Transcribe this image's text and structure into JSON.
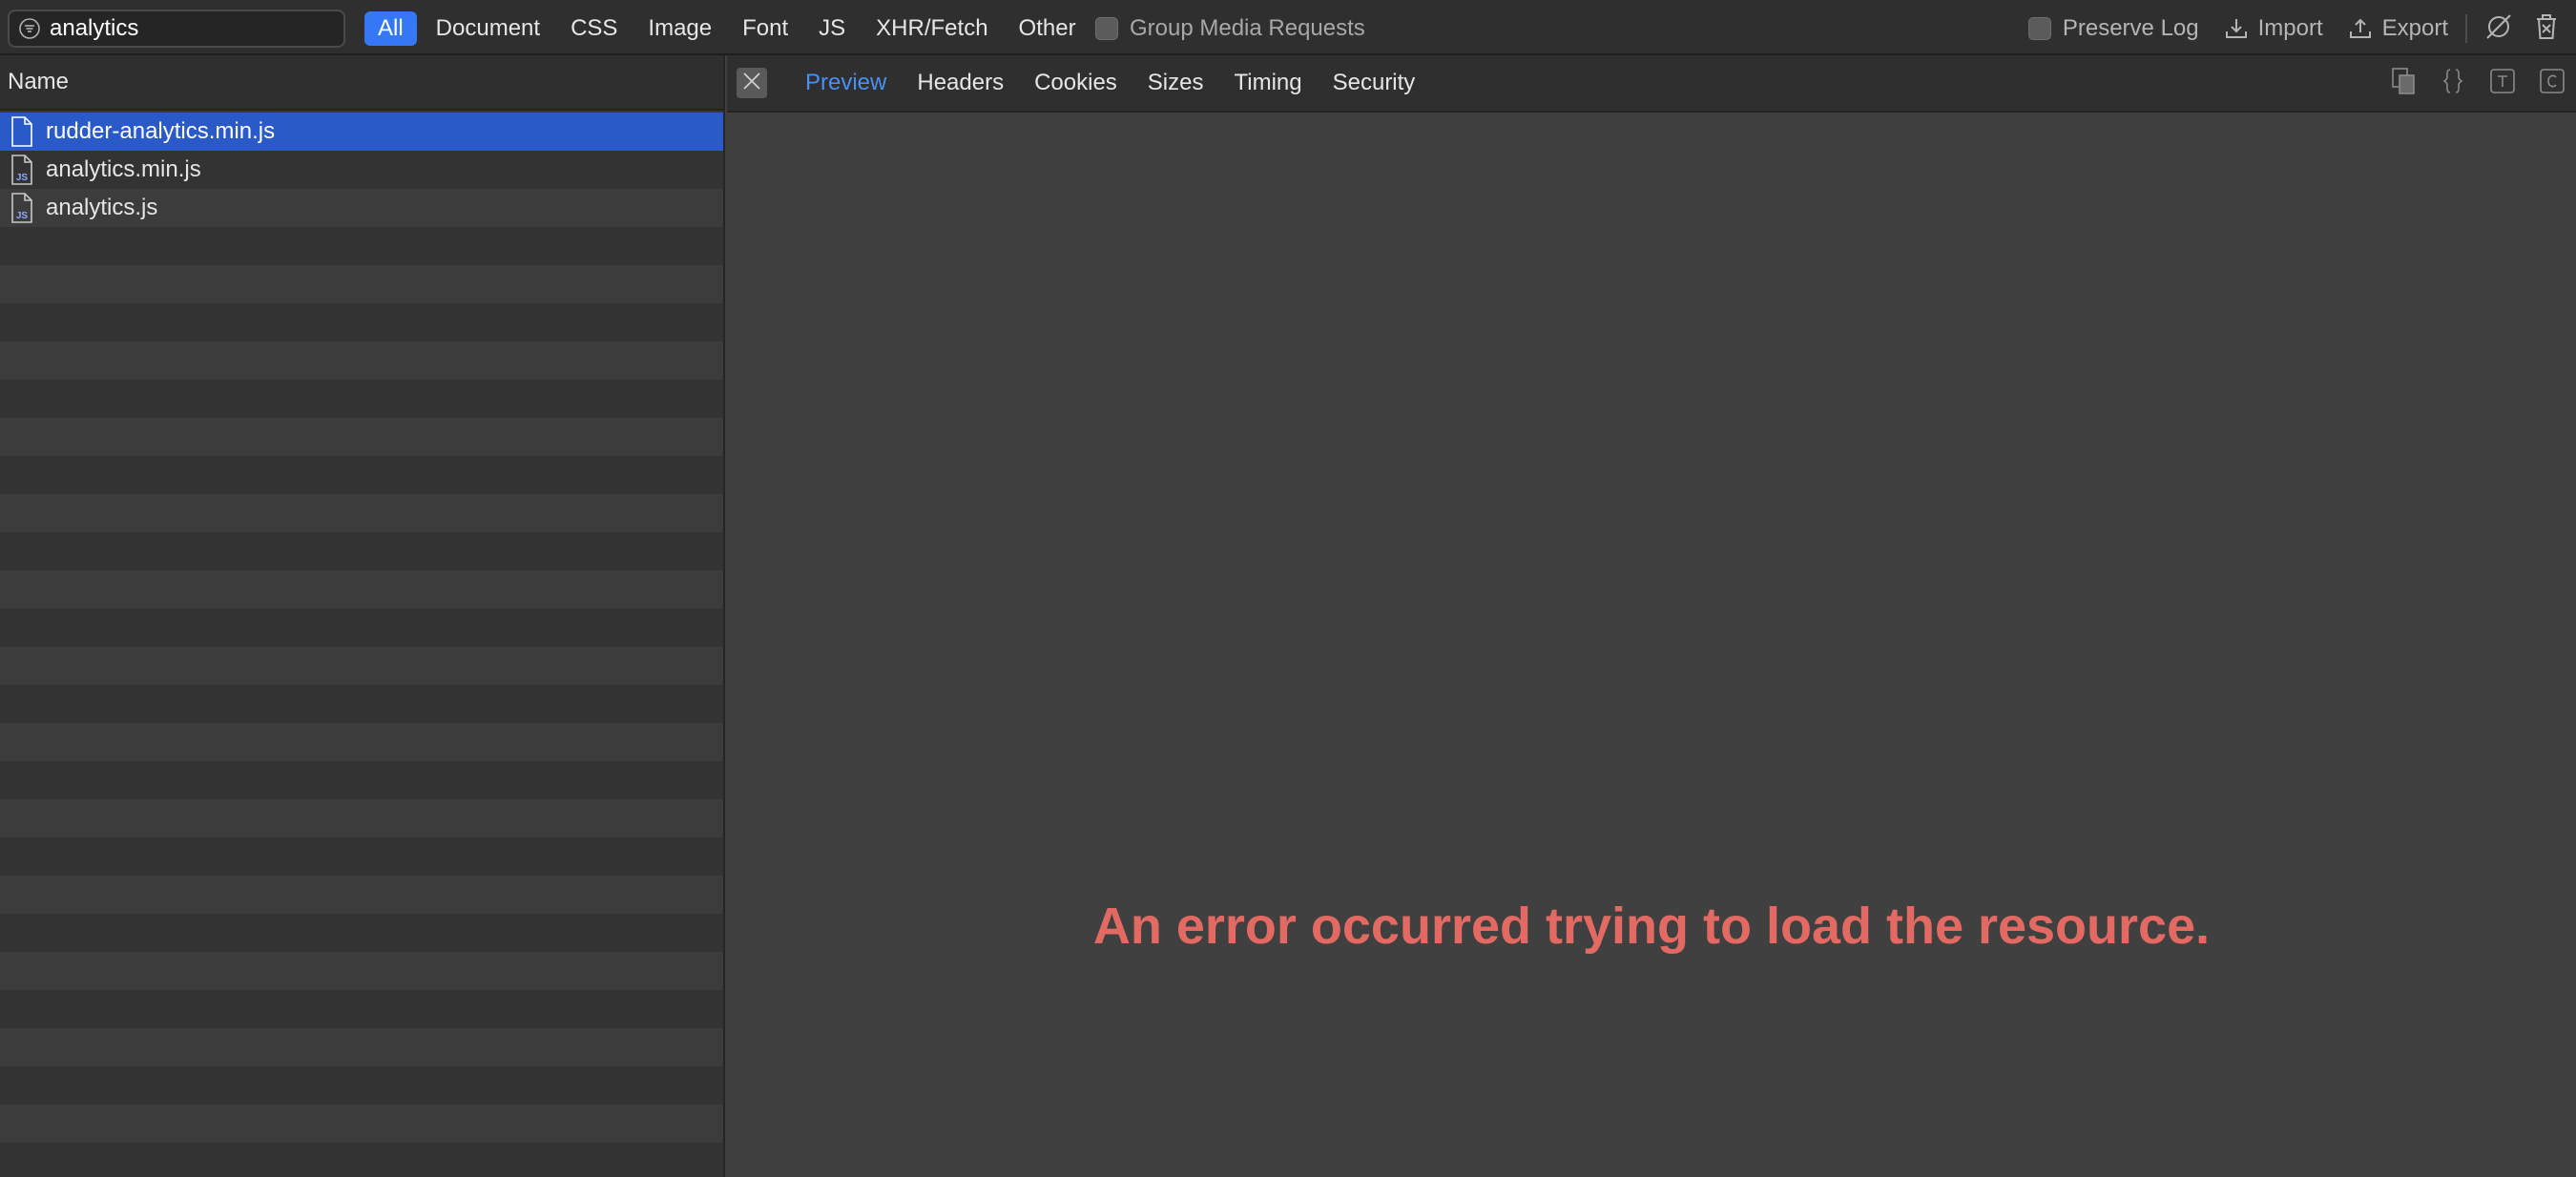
{
  "filter_bar": {
    "search_value": "analytics",
    "type_filters": [
      {
        "label": "All",
        "active": true
      },
      {
        "label": "Document",
        "active": false
      },
      {
        "label": "CSS",
        "active": false
      },
      {
        "label": "Image",
        "active": false
      },
      {
        "label": "Font",
        "active": false
      },
      {
        "label": "JS",
        "active": false
      },
      {
        "label": "XHR/Fetch",
        "active": false
      },
      {
        "label": "Other",
        "active": false
      }
    ],
    "group_media_label": "Group Media Requests",
    "preserve_log_label": "Preserve Log",
    "import_label": "Import",
    "export_label": "Export"
  },
  "resource_list": {
    "header": "Name",
    "items": [
      {
        "name": "rudder-analytics.min.js",
        "icon": "document-icon",
        "selected": true
      },
      {
        "name": "analytics.min.js",
        "icon": "js-file-icon",
        "selected": false
      },
      {
        "name": "analytics.js",
        "icon": "js-file-icon",
        "selected": false
      }
    ]
  },
  "detail": {
    "tabs": [
      {
        "label": "Preview",
        "active": true
      },
      {
        "label": "Headers",
        "active": false
      },
      {
        "label": "Cookies",
        "active": false
      },
      {
        "label": "Sizes",
        "active": false
      },
      {
        "label": "Timing",
        "active": false
      },
      {
        "label": "Security",
        "active": false
      }
    ],
    "error_message": "An error occurred trying to load the resource."
  },
  "colors": {
    "accent": "#3478f6",
    "selected_row": "#2a5ac8",
    "active_tab_text": "#4a8ff5",
    "error_text": "#e26a62"
  }
}
